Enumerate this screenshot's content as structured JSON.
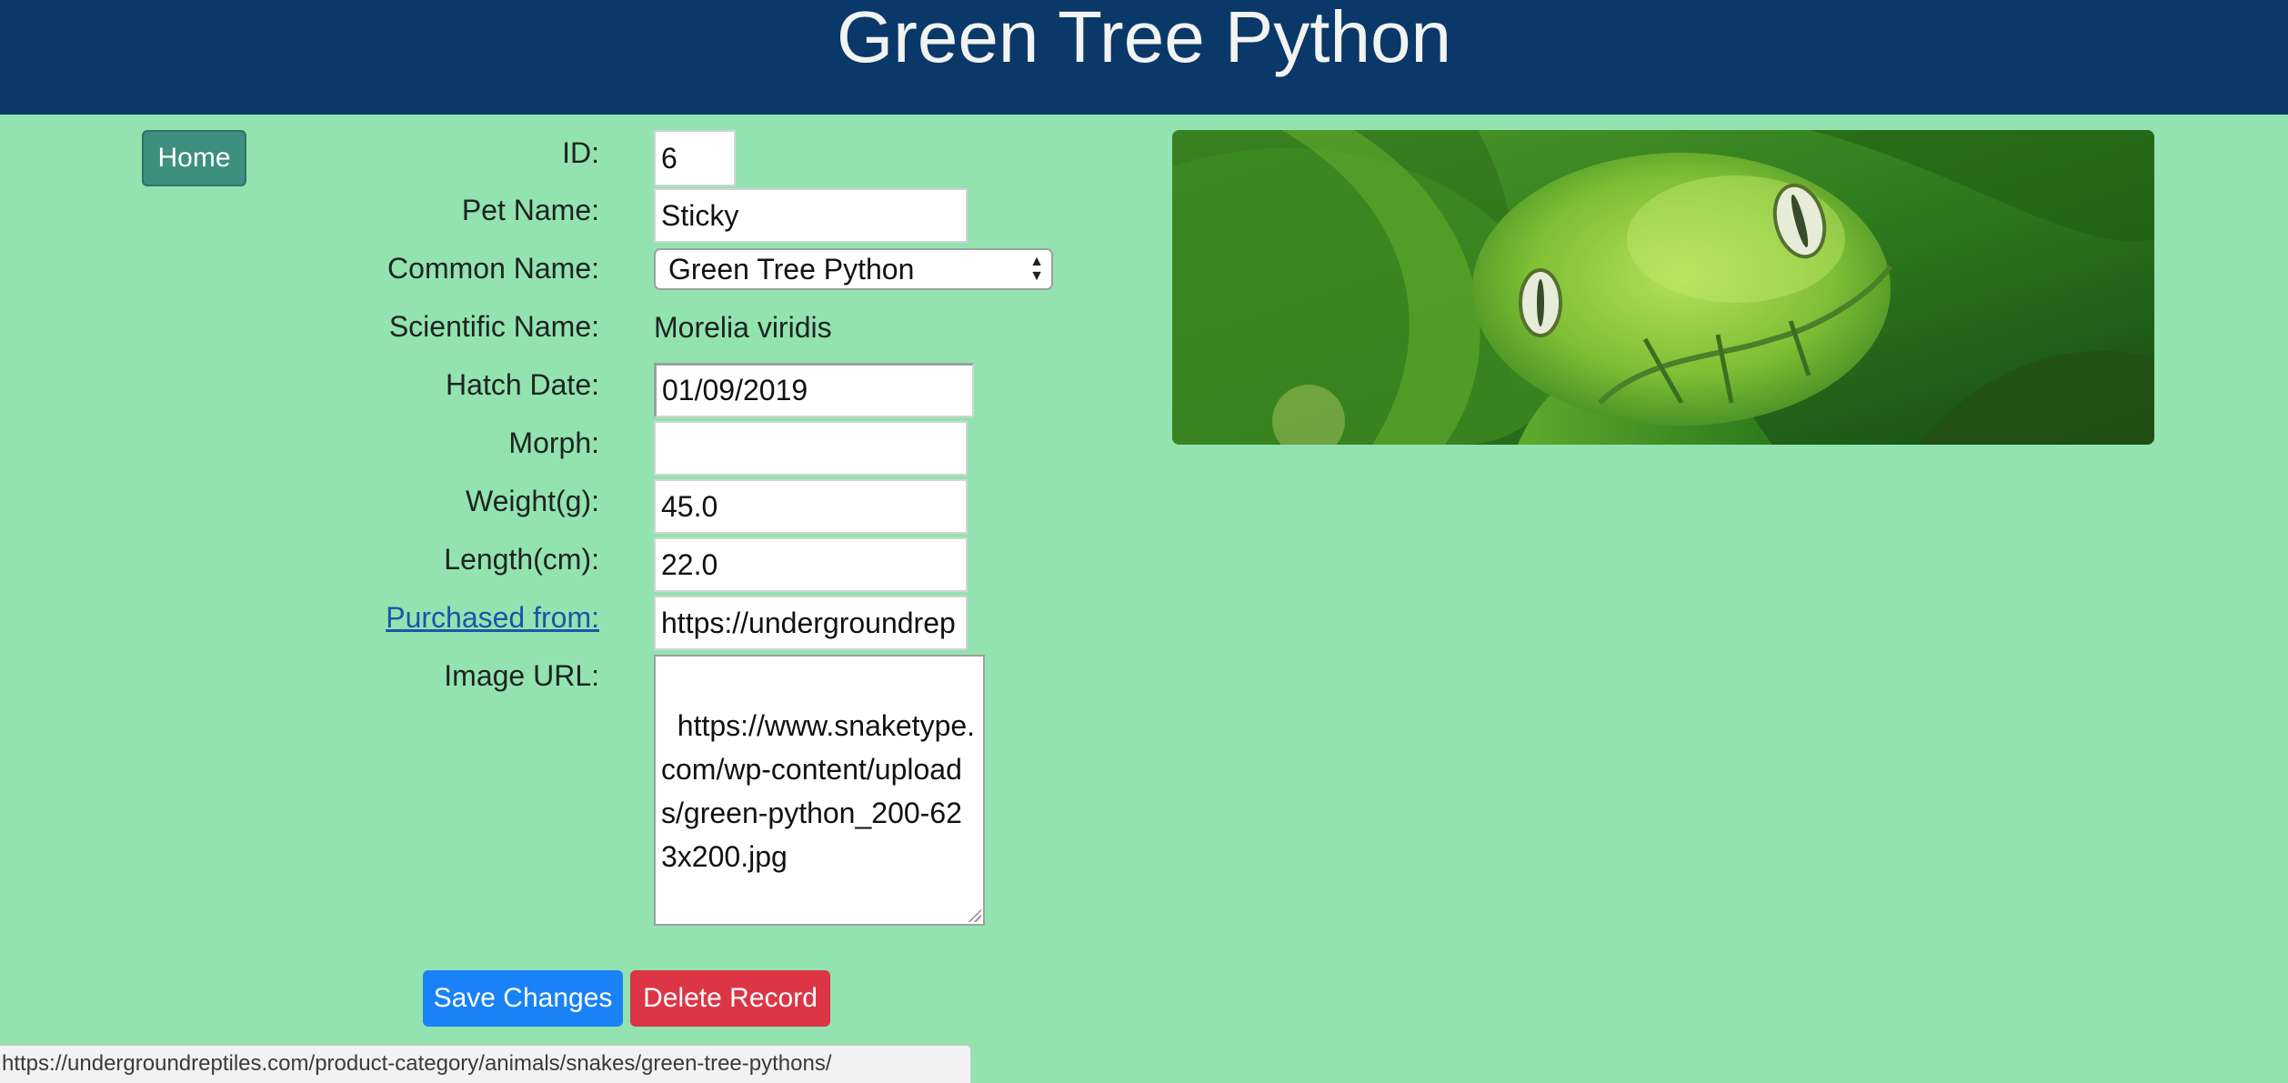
{
  "header": {
    "title": "Green Tree Python"
  },
  "nav": {
    "home_label": "Home"
  },
  "form": {
    "id": {
      "label": "ID:",
      "value": "6"
    },
    "pet_name": {
      "label": "Pet Name:",
      "value": "Sticky"
    },
    "common_name": {
      "label": "Common Name:",
      "selected": "Green Tree Python"
    },
    "scientific_name": {
      "label": "Scientific Name:",
      "value": "Morelia viridis"
    },
    "hatch_date": {
      "label": "Hatch Date:",
      "value": "01/09/2019"
    },
    "morph": {
      "label": "Morph:",
      "value": ""
    },
    "weight": {
      "label": "Weight(g):",
      "value": "45.0"
    },
    "length": {
      "label": "Length(cm):",
      "value": "22.0"
    },
    "purchased_from": {
      "label": "Purchased from:",
      "value": "https://undergroundrep"
    },
    "image_url": {
      "label": "Image URL:",
      "value": "https://www.snaketype.com/wp-content/uploads/green-python_200-623x200.jpg"
    }
  },
  "actions": {
    "save_label": "Save Changes",
    "delete_label": "Delete Record"
  },
  "status_bar": {
    "url": "https://undergroundreptiles.com/product-category/animals/snakes/green-tree-pythons/"
  },
  "colors": {
    "page_background": "#93e3b0",
    "header_background": "#0a3868",
    "home_button": "#3d8f80",
    "save_button": "#1a82f7",
    "delete_button": "#dc3545",
    "link": "#1558a8"
  },
  "icons": {
    "select_arrows": "select-arrows-icon",
    "resize_grip": "resize-grip-icon"
  }
}
